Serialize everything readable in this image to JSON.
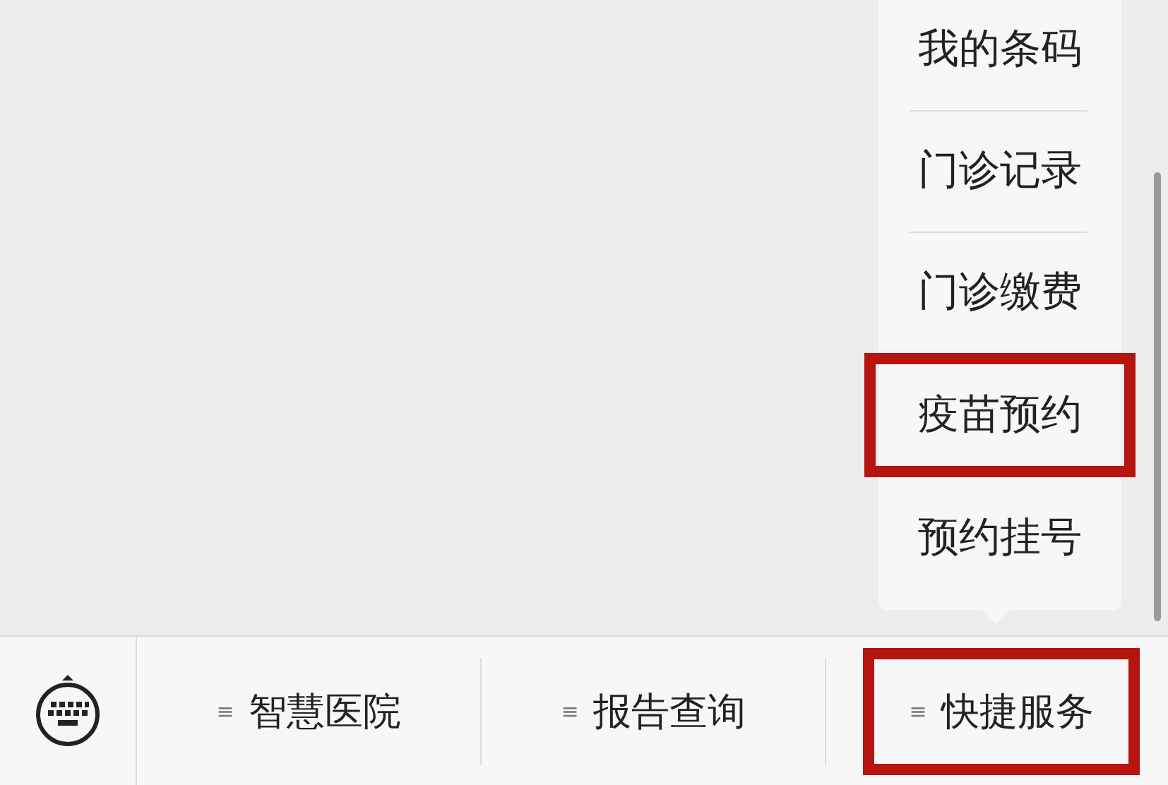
{
  "popup_menu": {
    "items": [
      {
        "label": "我的条码",
        "highlighted": false
      },
      {
        "label": "门诊记录",
        "highlighted": false
      },
      {
        "label": "门诊缴费",
        "highlighted": false
      },
      {
        "label": "疫苗预约",
        "highlighted": true
      },
      {
        "label": "预约挂号",
        "highlighted": false
      }
    ]
  },
  "menu_bar": {
    "items": [
      {
        "icon": "≡",
        "label": "智慧医院",
        "highlighted": false
      },
      {
        "icon": "≡",
        "label": "报告查询",
        "highlighted": false
      },
      {
        "icon": "≡",
        "label": "快捷服务",
        "highlighted": true
      }
    ]
  }
}
